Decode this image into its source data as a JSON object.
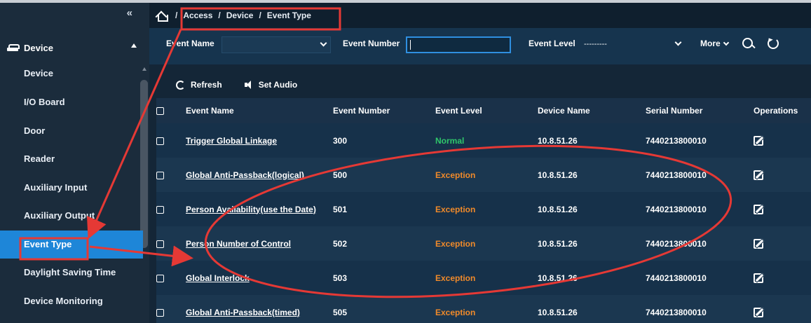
{
  "sidebar": {
    "collapse_glyph": "«",
    "section_title": "Device",
    "items": [
      {
        "label": "Device"
      },
      {
        "label": "I/O Board"
      },
      {
        "label": "Door"
      },
      {
        "label": "Reader"
      },
      {
        "label": "Auxiliary Input"
      },
      {
        "label": "Auxiliary Output"
      },
      {
        "label": "Event Type"
      },
      {
        "label": "Daylight Saving Time"
      },
      {
        "label": "Device Monitoring"
      }
    ]
  },
  "breadcrumb": {
    "items": [
      "Access",
      "Device",
      "Event Type"
    ],
    "separator": "/"
  },
  "filters": {
    "event_name_label": "Event Name",
    "event_name_value": "",
    "event_number_label": "Event Number",
    "event_number_value": "",
    "event_level_label": "Event Level",
    "event_level_value": "---------",
    "more_label": "More"
  },
  "toolbar": {
    "refresh_label": "Refresh",
    "set_audio_label": "Set Audio"
  },
  "table": {
    "headers": [
      "Event Name",
      "Event Number",
      "Event Level",
      "Device Name",
      "Serial Number",
      "Operations"
    ],
    "rows": [
      {
        "name": "Trigger Global Linkage",
        "number": "300",
        "level": "Normal",
        "device": "10.8.51.26",
        "serial": "7440213800010"
      },
      {
        "name": "Global Anti-Passback(logical)",
        "number": "500",
        "level": "Exception",
        "device": "10.8.51.26",
        "serial": "7440213800010"
      },
      {
        "name": "Person Availability(use the Date)",
        "number": "501",
        "level": "Exception",
        "device": "10.8.51.26",
        "serial": "7440213800010"
      },
      {
        "name": "Person Number of Control",
        "number": "502",
        "level": "Exception",
        "device": "10.8.51.26",
        "serial": "7440213800010"
      },
      {
        "name": "Global Interlock",
        "number": "503",
        "level": "Exception",
        "device": "10.8.51.26",
        "serial": "7440213800010"
      },
      {
        "name": "Global Anti-Passback(timed)",
        "number": "505",
        "level": "Exception",
        "device": "10.8.51.26",
        "serial": "7440213800010"
      }
    ]
  },
  "colors": {
    "accent": "#1e86d8",
    "annotation_red": "#e53935",
    "normal": "#2fc66a",
    "exception": "#f08a2a"
  }
}
